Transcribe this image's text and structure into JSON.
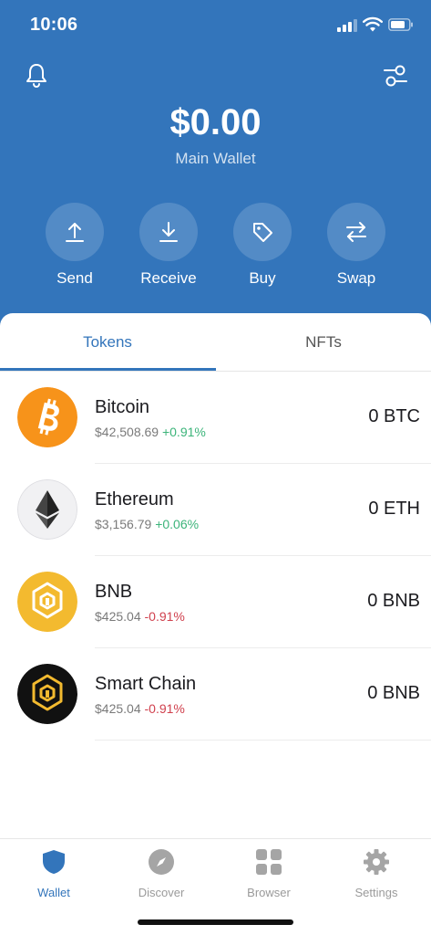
{
  "status_bar": {
    "time": "10:06"
  },
  "header": {
    "balance": "$0.00",
    "wallet_name": "Main Wallet",
    "icons": {
      "left": "bell-icon",
      "right": "filter-settings-icon"
    }
  },
  "actions": [
    {
      "label": "Send",
      "icon": "arrow-up-icon"
    },
    {
      "label": "Receive",
      "icon": "arrow-down-icon"
    },
    {
      "label": "Buy",
      "icon": "tag-icon"
    },
    {
      "label": "Swap",
      "icon": "swap-arrows-icon"
    }
  ],
  "tabs": [
    {
      "label": "Tokens",
      "active": true
    },
    {
      "label": "NFTs",
      "active": false
    }
  ],
  "tokens": [
    {
      "name": "Bitcoin",
      "price": "$42,508.69",
      "change": "+0.91%",
      "amount": "0 BTC",
      "icon": "bitcoin-logo"
    },
    {
      "name": "Ethereum",
      "price": "$3,156.79",
      "change": "+0.06%",
      "amount": "0 ETH",
      "icon": "ethereum-logo"
    },
    {
      "name": "BNB",
      "price": "$425.04",
      "change": "-0.91%",
      "amount": "0 BNB",
      "icon": "bnb-logo"
    },
    {
      "name": "Smart Chain",
      "price": "$425.04",
      "change": "-0.91%",
      "amount": "0 BNB",
      "icon": "smart-chain-logo"
    }
  ],
  "bottom_nav": [
    {
      "label": "Wallet",
      "icon": "shield-icon",
      "active": true
    },
    {
      "label": "Discover",
      "icon": "compass-icon",
      "active": false
    },
    {
      "label": "Browser",
      "icon": "grid-icon",
      "active": false
    },
    {
      "label": "Settings",
      "icon": "gear-icon",
      "active": false
    }
  ],
  "colors": {
    "brand_blue": "#3375bb",
    "positive": "#3cb47a",
    "negative": "#d0414e",
    "bitcoin": "#f7931a",
    "bnb": "#f3ba2f"
  }
}
